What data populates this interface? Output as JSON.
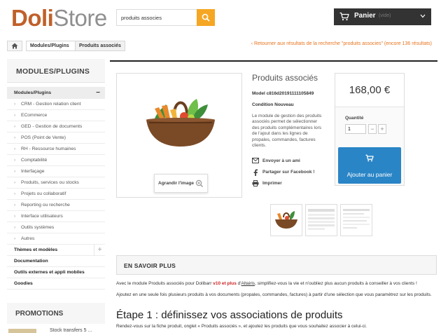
{
  "logo": {
    "part1": "Doli",
    "part2": "Store"
  },
  "search": {
    "value": "produits associes"
  },
  "cart": {
    "label": "Panier",
    "empty": "(vide)"
  },
  "breadcrumb": {
    "section": "Modules/Plugins",
    "current": "Produits associés"
  },
  "back_link": "Retourner aux résultats de la recherche \"produits associes\" (encore 136 résultats)",
  "sidebar": {
    "title": "MODULES/PLUGINS",
    "head": "Modules/Plugins",
    "categories": [
      "CRM - Gestion relation client",
      "ECommerce",
      "GED - Gestion de documents",
      "POS (Point de Vente)",
      "RH - Ressource humaines",
      "Comptabilité",
      "Interfaçage",
      "Produits, services ou stocks",
      "Projets ou collaboratif",
      "Reporting ou recherche",
      "Interface utilisateurs",
      "Outils systèmes",
      "Autres"
    ],
    "top_items": [
      "Thèmes et modèles",
      "Documentation",
      "Outils externes et appli mobiles",
      "Goodies"
    ],
    "promotions": "PROMOTIONS",
    "promo_item": "Stock transfers 5 ..."
  },
  "product": {
    "title": "Produits associés",
    "model_label": "Model",
    "model": "c816d20191111105849",
    "condition_label": "Condition",
    "condition": "Nouveau",
    "description": "Le module de gestion des produits associés permet de sélectionner des produits complémentaires lors de l'ajout dans les lignes de propales, commandes, factures clients.",
    "zoom_label": "Agrandir l'image",
    "actions": {
      "email": "Envoyer à un ami",
      "facebook": "Partager sur Facebook !",
      "print": "Imprimer"
    }
  },
  "buy": {
    "price": "168,00 €",
    "qty_label": "Quantité",
    "qty_value": "1",
    "add_label": "Ajouter au panier"
  },
  "more": {
    "title": "EN SAVOIR PLUS",
    "p1_a": "Avec le module Produits associés pour Dolibarr ",
    "p1_ver": "v10 et plus",
    "p1_b": " d'",
    "p1_link": "Altairis",
    "p1_c": ", simplifiez-vous la vie et n'oubliez plus aucun produits à conseiller à vos clients !",
    "p2": "Ajoutez en une seule fois plusieurs produits à vos documents (propales, commandes, factures) à partir d'une sélection que vous paramétrez sur les produits.",
    "h2": "Étape 1 : définissez vos associations de produits",
    "p3": "Rendez-vous sur la fiche produit, onglet « Produits associés », et ajoutez les produits que vous souhaitez associer à celui-ci."
  },
  "colors": {
    "accent": "#f5a623",
    "brand": "#c0602a",
    "button": "#2a85c6",
    "link": "#e8731d"
  },
  "icons": [
    "search-icon",
    "cart-icon",
    "chevron-down-icon",
    "home-icon",
    "chevron-left-icon",
    "minus-icon",
    "plus-icon",
    "magnifier-plus-icon",
    "envelope-icon",
    "facebook-icon",
    "printer-icon"
  ]
}
